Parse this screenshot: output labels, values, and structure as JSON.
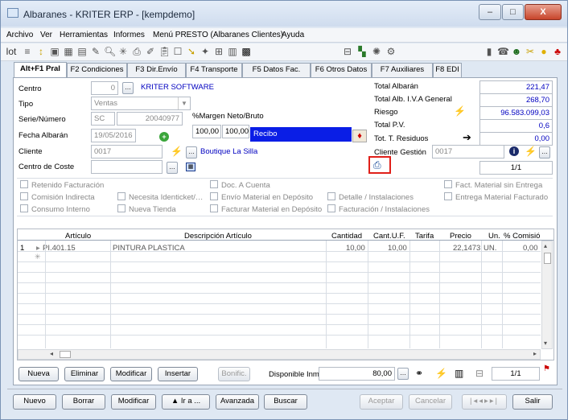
{
  "window": {
    "title": "Albaranes - KRITER ERP - [kempdemo]",
    "min": "–",
    "max": "□",
    "close": "X"
  },
  "menu": [
    "Archivo",
    "Ver",
    "Herramientas",
    "Informes",
    "Menú PRESTO (Albaranes Clientes)",
    "Ayuda"
  ],
  "toolbar": {
    "lot": "lot"
  },
  "tabs": [
    "Alt+F1 Pral",
    "F2 Condiciones",
    "F3 Dir.Envío",
    "F4 Transporte",
    "F5 Datos Fac.",
    "F6 Otros Datos",
    "F7 Auxiliares",
    "F8 EDI"
  ],
  "form": {
    "centro_label": "Centro",
    "centro_value": "0",
    "centro_name": "KRITER SOFTWARE",
    "tipo_label": "Tipo",
    "tipo_value": "Ventas",
    "serie_label": "Serie/Número",
    "serie_value": "SC",
    "numero_value": "20040977",
    "margen_label": "%Margen Neto/Bruto",
    "margen_neto": "100,00",
    "margen_bruto": "100,00",
    "recibo": "Recibo",
    "fecha_label": "Fecha Albarán",
    "fecha_value": "19/05/2016",
    "cliente_label": "Cliente",
    "cliente_value": "0017",
    "cliente_name": "Boutique La Silla",
    "coste_label": "Centro de Coste",
    "coste_value": ""
  },
  "totals": {
    "total_albaran_label": "Total Albarán",
    "total_albaran": "221,47",
    "total_iva_label": "Total Alb. I.V.A General",
    "total_iva": "268,70",
    "riesgo_label": "Riesgo",
    "riesgo": "96.583.099,03",
    "pv_label": "Total P.V.",
    "pv": "0,6",
    "residuos_label": "Tot. T. Residuos",
    "residuos": "0,00",
    "gestion_label": "Cliente Gestión",
    "gestion": "0017",
    "page": "1/1"
  },
  "checks": {
    "col1": [
      "Retenido Facturación",
      "Comisión Indirecta",
      "Consumo Interno"
    ],
    "col2": [
      "Necesita Identicket/…",
      "Nueva Tienda"
    ],
    "col3": [
      "Doc. A Cuenta",
      "Envío Material en Depósito",
      "Facturar Material en Depósito"
    ],
    "col4": [
      "Detalle / Instalaciones",
      "Facturación / Instalaciones"
    ],
    "col5": [
      "Fact. Material sin Entrega",
      "Entrega Material Facturado"
    ]
  },
  "grid": {
    "headers": [
      "Artículo",
      "Descripción Artículo",
      "Cantidad",
      "Cant.U.F.",
      "Tarifa",
      "Precio",
      "Un.",
      "% Comisió"
    ],
    "rows": [
      {
        "n": "1",
        "articulo": "PI.401.15",
        "descripcion": "PINTURA PLASTICA",
        "cantidad": "10,00",
        "cantuf": "10,00",
        "tarifa": "",
        "precio": "22,1473",
        "un": "UN.",
        "comision": "0,00"
      }
    ]
  },
  "bottom": {
    "nueva": "Nueva",
    "eliminar": "Eliminar",
    "modificar": "Modificar",
    "insertar": "Insertar",
    "bonific": "Bonific.",
    "disponible_label": "Disponible Inm",
    "disponible": "80,00",
    "page": "1/1"
  },
  "footer": {
    "nuevo": "Nuevo",
    "borrar": "Borrar",
    "modificar": "Modificar",
    "ira": "▲ Ir a ...",
    "avanzada": "Avanzada",
    "buscar": "Buscar",
    "aceptar": "Aceptar",
    "cancelar": "Cancelar",
    "salir": "Salir"
  }
}
